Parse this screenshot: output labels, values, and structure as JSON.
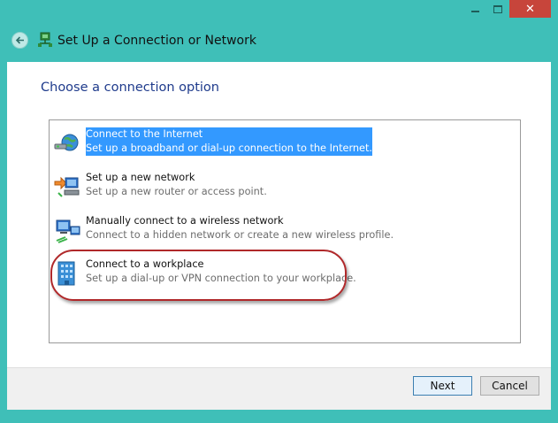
{
  "window": {
    "title": "Set Up a Connection or Network",
    "close_glyph": "✕"
  },
  "main": {
    "heading": "Choose a connection option",
    "options": [
      {
        "title": "Connect to the Internet",
        "desc": "Set up a broadband or dial-up connection to the Internet.",
        "icon": "globe-internet-icon",
        "selected": true
      },
      {
        "title": "Set up a new network",
        "desc": "Set up a new router or access point.",
        "icon": "new-network-icon",
        "selected": false
      },
      {
        "title": "Manually connect to a wireless network",
        "desc": "Connect to a hidden network or create a new wireless profile.",
        "icon": "wireless-network-icon",
        "selected": false
      },
      {
        "title": "Connect to a workplace",
        "desc": "Set up a dial-up or VPN connection to your workplace.",
        "icon": "workplace-vpn-icon",
        "selected": false
      }
    ]
  },
  "footer": {
    "next_label": "Next",
    "cancel_label": "Cancel"
  },
  "colors": {
    "window_frame": "#3fbfb8",
    "selection": "#3399ff",
    "heading": "#1f3b8c",
    "annotation_circle": "#b0282a"
  }
}
